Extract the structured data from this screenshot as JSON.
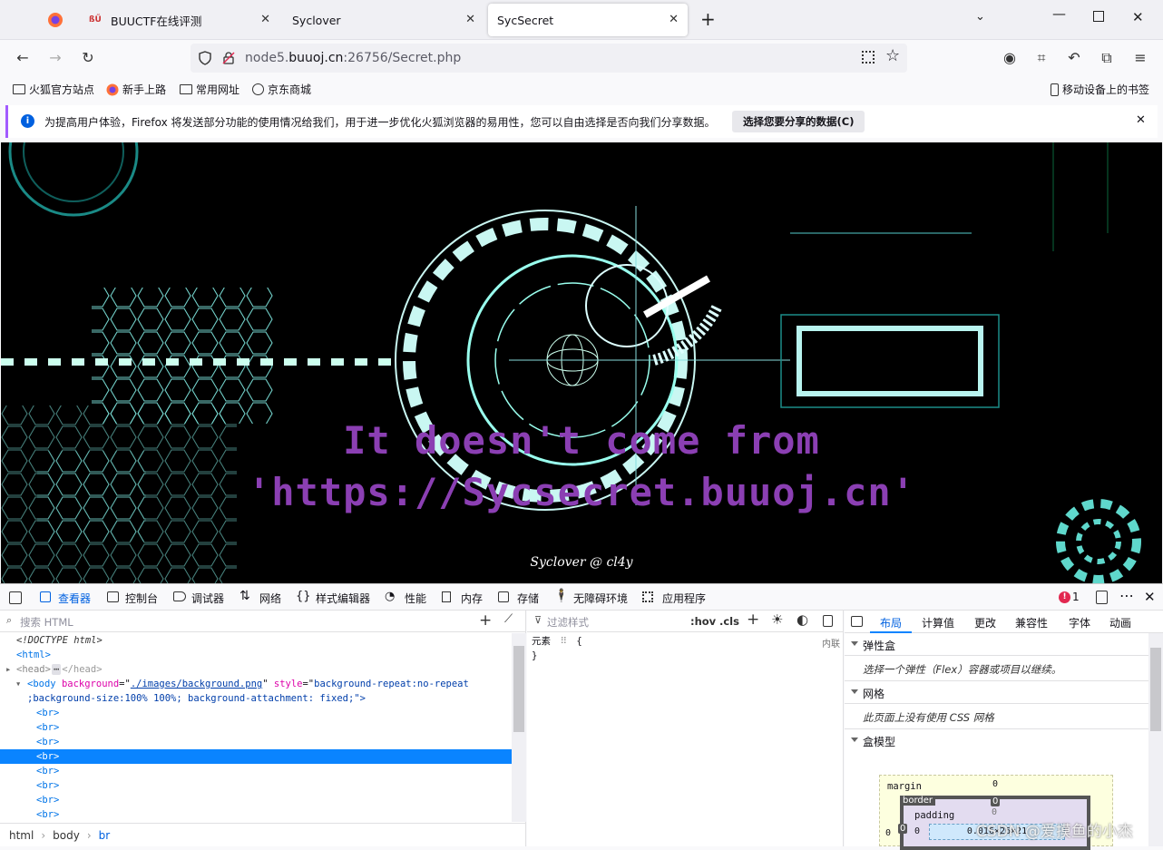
{
  "tabs": [
    {
      "label": ""
    },
    {
      "label": "BUUCTF在线评测"
    },
    {
      "label": "Syclover"
    },
    {
      "label": "SycSecret"
    }
  ],
  "url": {
    "host_pre": "node5.",
    "host": "buuoj.cn",
    "rest": ":26756/Secret.php"
  },
  "bookmarks": [
    "火狐官方站点",
    "新手上路",
    "常用网址",
    "京东商城"
  ],
  "mobile_bookmarks": "移动设备上的书签",
  "notification": {
    "text": "为提高用户体验，Firefox 将发送部分功能的使用情况给我们，用于进一步优化火狐浏览器的易用性，您可以自由选择是否向我们分享数据。",
    "button": "选择您要分享的数据(C)"
  },
  "page": {
    "line1": "It doesn't come from",
    "line2": "'https://Sycsecret.buuoj.cn'",
    "signature": "Syclover @ cl4y"
  },
  "devtools": {
    "tabs": [
      "查看器",
      "控制台",
      "调试器",
      "网络",
      "样式编辑器",
      "性能",
      "内存",
      "存储",
      "无障碍环境",
      "应用程序"
    ],
    "error_count": "1",
    "search_html": "搜索 HTML",
    "filter_styles": "过滤样式",
    "hov": ":hov",
    "cls": ".cls",
    "rule_selector": "元素",
    "rule_brace_open": "{",
    "rule_brace_close": "}",
    "inline": "内联",
    "html_lines": [
      {
        "text": "<!DOCTYPE html>"
      },
      {
        "text": "<html>"
      },
      {
        "text": "<head>"
      },
      {
        "text": "<body"
      },
      {
        "text": ";background-size:100% 100%; background-attachment: fixed;\">"
      },
      {
        "text": "<br>"
      }
    ],
    "body_attrs": {
      "a1": "background",
      "v1": "./images/background.png",
      "a2": "style",
      "v2": "background-repeat:no-repeat"
    },
    "breadcrumbs": [
      "html",
      "body",
      "br"
    ],
    "right_tabs": [
      "布局",
      "计算值",
      "更改",
      "兼容性",
      "字体",
      "动画"
    ],
    "flexbox_title": "弹性盒",
    "flexbox_desc": "选择一个弹性（Flex）容器或项目以继续。",
    "grid_title": "网格",
    "grid_desc": "此页面上没有使用 CSS 网格",
    "boxmodel_title": "盒模型",
    "box": {
      "margin": "margin",
      "border": "border",
      "padding": "padding",
      "zero": "0",
      "size": "0.016×26×21"
    }
  },
  "watermark": "CSDN @爱摸鱼的小杰"
}
